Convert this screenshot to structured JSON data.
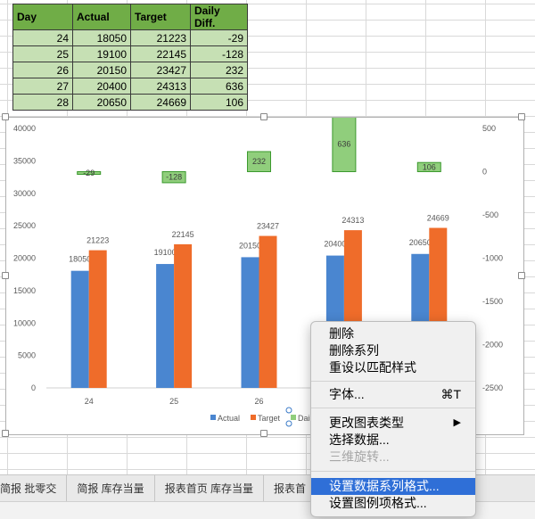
{
  "sheet": {
    "headers": [
      "Day",
      "Actual",
      "Target",
      "Daily Diff."
    ],
    "rows": [
      [
        "24",
        "18050",
        "21223",
        "-29"
      ],
      [
        "25",
        "19100",
        "22145",
        "-128"
      ],
      [
        "26",
        "20150",
        "23427",
        "232"
      ],
      [
        "27",
        "20400",
        "24313",
        "636"
      ],
      [
        "28",
        "20650",
        "24669",
        "106"
      ]
    ]
  },
  "chart_data": {
    "type": "bar",
    "categories": [
      "24",
      "25",
      "26",
      "27",
      "28"
    ],
    "series": [
      {
        "name": "Actual",
        "values": [
          18050,
          19100,
          20150,
          20400,
          20650
        ],
        "color": "#4a86d0"
      },
      {
        "name": "Target",
        "values": [
          21223,
          22145,
          23427,
          24313,
          24669
        ],
        "color": "#ef6c2a"
      },
      {
        "name": "Daily Diff.",
        "values": [
          -29,
          -128,
          232,
          636,
          106
        ],
        "color": "#90ce7c",
        "axis": "secondary"
      }
    ],
    "ylim": [
      0,
      40000
    ],
    "y_ticks": [
      "0",
      "5000",
      "10000",
      "15000",
      "20000",
      "25000",
      "30000",
      "35000",
      "40000"
    ],
    "y2lim": [
      -2500,
      500
    ],
    "y2_ticks": [
      "500",
      "0",
      "-500",
      "-1000",
      "-1500",
      "-2000",
      "-2500"
    ],
    "legend": [
      "Actual",
      "Target",
      "Daily D"
    ],
    "legend_position": "bottom"
  },
  "tabs": [
    "简报 批零交",
    "简报 库存当量",
    "报表首页 库存当量",
    "报表首"
  ],
  "context_menu": {
    "items": [
      {
        "label": "删除",
        "shortcut": "",
        "disabled": false,
        "highlighted": false
      },
      {
        "label": "删除系列",
        "shortcut": "",
        "disabled": false,
        "highlighted": false
      },
      {
        "label": "重设以匹配样式",
        "shortcut": "",
        "disabled": false,
        "highlighted": false
      },
      {
        "label": "字体...",
        "shortcut": "⌘T",
        "disabled": false,
        "highlighted": false
      },
      {
        "label": "更改图表类型",
        "shortcut": "▶",
        "disabled": false,
        "highlighted": false
      },
      {
        "label": "选择数据...",
        "shortcut": "",
        "disabled": false,
        "highlighted": false
      },
      {
        "label": "三维旋转...",
        "shortcut": "",
        "disabled": true,
        "highlighted": false
      },
      {
        "label": "设置数据系列格式...",
        "shortcut": "",
        "disabled": false,
        "highlighted": true
      },
      {
        "label": "设置图例项格式...",
        "shortcut": "",
        "disabled": false,
        "highlighted": false
      }
    ]
  }
}
